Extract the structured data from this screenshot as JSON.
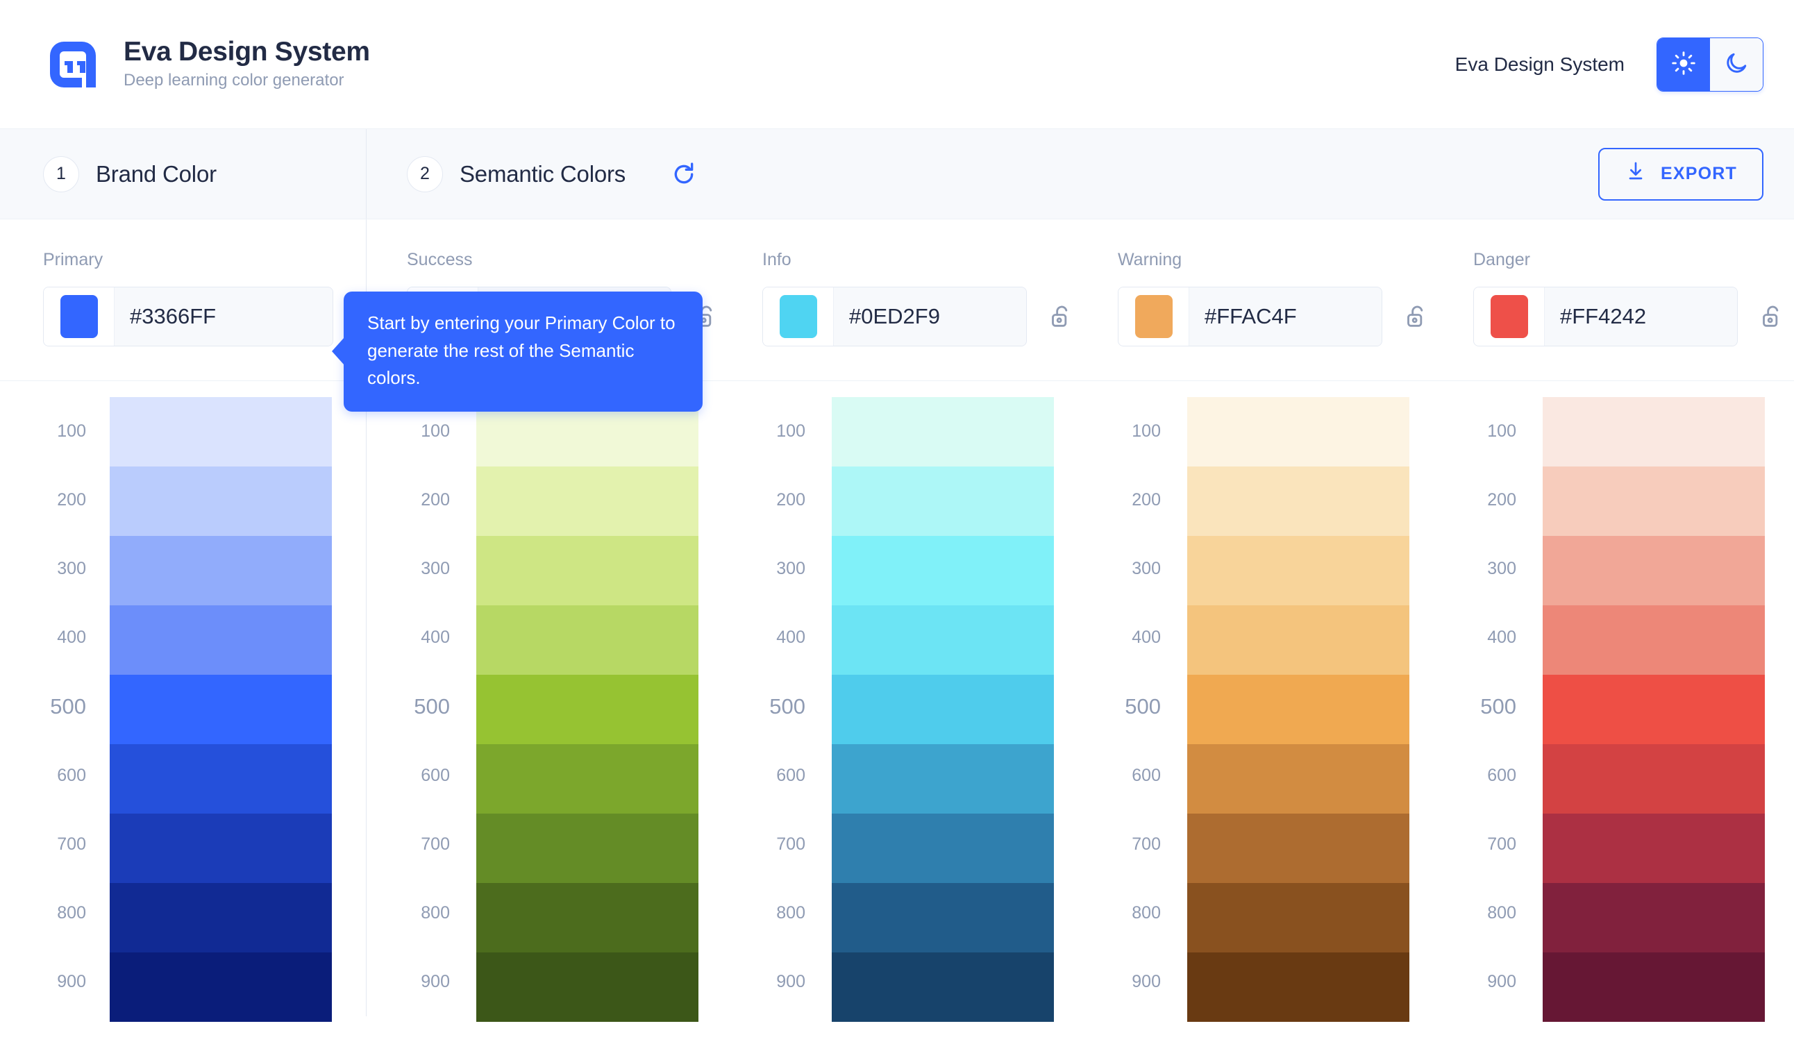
{
  "header": {
    "logo_icon": "eva-logo-icon",
    "title": "Eva Design System",
    "subtitle": "Deep learning color generator",
    "app_name": "Eva Design System",
    "theme": {
      "light_icon": "sun-icon",
      "dark_icon": "moon-icon",
      "active": "light"
    }
  },
  "steps": {
    "brand": {
      "number": "1",
      "label": "Brand Color"
    },
    "semantic": {
      "number": "2",
      "label": "Semantic Colors",
      "refresh_icon": "refresh-icon"
    },
    "export": {
      "label": "EXPORT",
      "icon": "download-icon"
    }
  },
  "tooltip": {
    "text": "Start by entering your Primary Color to generate the rest of the Semantic colors."
  },
  "colors": {
    "accent": "#3366FF",
    "text": "#222B45",
    "muted": "#8F9BB3",
    "panel": "#F7F9FC",
    "border": "#E4E9F2"
  },
  "shade_keys": [
    "100",
    "200",
    "300",
    "400",
    "500",
    "600",
    "700",
    "800",
    "900"
  ],
  "main_shade": "500",
  "palettes": [
    {
      "name": "Primary",
      "value": "#3366FF",
      "swatch": "#3366FF",
      "lockable": false,
      "lock_icon": null,
      "shades": {
        "100": "#DAE3FE",
        "200": "#BACCFD",
        "300": "#91ACFB",
        "400": "#6C8EFA",
        "500": "#3366FF",
        "600": "#2550DB",
        "700": "#1B3CB8",
        "800": "#112A94",
        "900": "#0A1D7A"
      }
    },
    {
      "name": "Success",
      "value": "#",
      "swatch": null,
      "lockable": true,
      "lock_icon": "unlock-icon",
      "shades": {
        "100": "#F1F9D7",
        "200": "#E3F2AE",
        "300": "#CEE684",
        "400": "#B7D864",
        "500": "#96C332",
        "600": "#7CA72C",
        "700": "#648C26",
        "800": "#4C6C1D",
        "900": "#3C5718"
      }
    },
    {
      "name": "Info",
      "value": "#0ED2F9",
      "swatch": "#4FD4F2",
      "lockable": true,
      "lock_icon": "unlock-icon",
      "shades": {
        "100": "#D9FBF4",
        "200": "#ADF7F7",
        "300": "#80F1F9",
        "400": "#6CE4F4",
        "500": "#4FCCEC",
        "600": "#3DA4CE",
        "700": "#2F7FAE",
        "800": "#215C8A",
        "900": "#17436B"
      }
    },
    {
      "name": "Warning",
      "value": "#FFAC4F",
      "swatch": "#F0A95C",
      "lockable": true,
      "lock_icon": "unlock-icon",
      "shades": {
        "100": "#FDF4E3",
        "200": "#FAE4BC",
        "300": "#F8D49A",
        "400": "#F4C47D",
        "500": "#F0A951",
        "600": "#D28C41",
        "700": "#AD6C30",
        "800": "#89511F",
        "900": "#693A12"
      }
    },
    {
      "name": "Danger",
      "value": "#FF4242",
      "swatch": "#EE5049",
      "lockable": true,
      "lock_icon": "unlock-icon",
      "shades": {
        "100": "#FAE8E1",
        "200": "#F7CCBC",
        "300": "#F1A797",
        "400": "#ED8778",
        "500": "#EE4F45",
        "600": "#D34243",
        "700": "#AC3043",
        "800": "#81213D",
        "900": "#661734"
      }
    }
  ]
}
